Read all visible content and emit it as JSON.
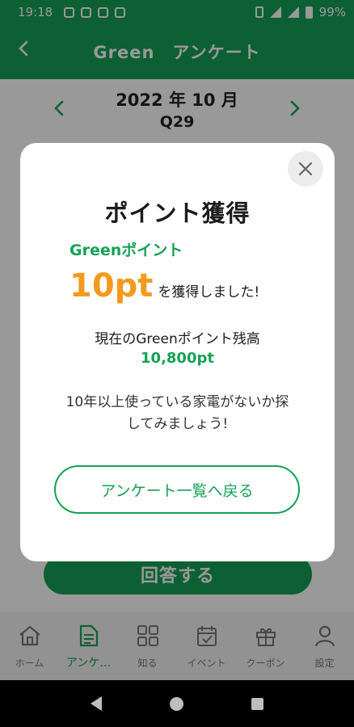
{
  "status_bar": {
    "time": "19:18",
    "battery": "99%"
  },
  "app_bar": {
    "back_icon": "chevron-left-icon",
    "title": "Green　アンケート"
  },
  "survey": {
    "date": "2022 年 10 月",
    "question": "Q29",
    "prev_icon": "chevron-left-icon",
    "next_icon": "chevron-right-icon",
    "answer_button": "回答する"
  },
  "dialog": {
    "heading": "ポイント獲得",
    "points_label": "Greenポイント",
    "points_value": "10pt",
    "points_suffix": "を獲得しました!",
    "balance_label": "現在のGreenポイント残高",
    "balance_value": "10,800pt",
    "tip_line1": "10年以上使っている家電がないか探",
    "tip_line2": "してみましょう!",
    "return_button": "アンケート一覧へ戻る",
    "close_icon": "close-icon"
  },
  "bottom_nav": {
    "items": [
      {
        "label": "ホーム",
        "icon": "home-icon",
        "active": false
      },
      {
        "label": "アンケ…",
        "icon": "document-icon",
        "active": true
      },
      {
        "label": "知る",
        "icon": "grid-icon",
        "active": false
      },
      {
        "label": "イベント",
        "icon": "calendar-icon",
        "active": false
      },
      {
        "label": "クーポン",
        "icon": "gift-icon",
        "active": false
      },
      {
        "label": "設定",
        "icon": "person-icon",
        "active": false
      }
    ]
  },
  "colors": {
    "brand_green": "#15a155",
    "points_orange": "#f39a1d"
  }
}
